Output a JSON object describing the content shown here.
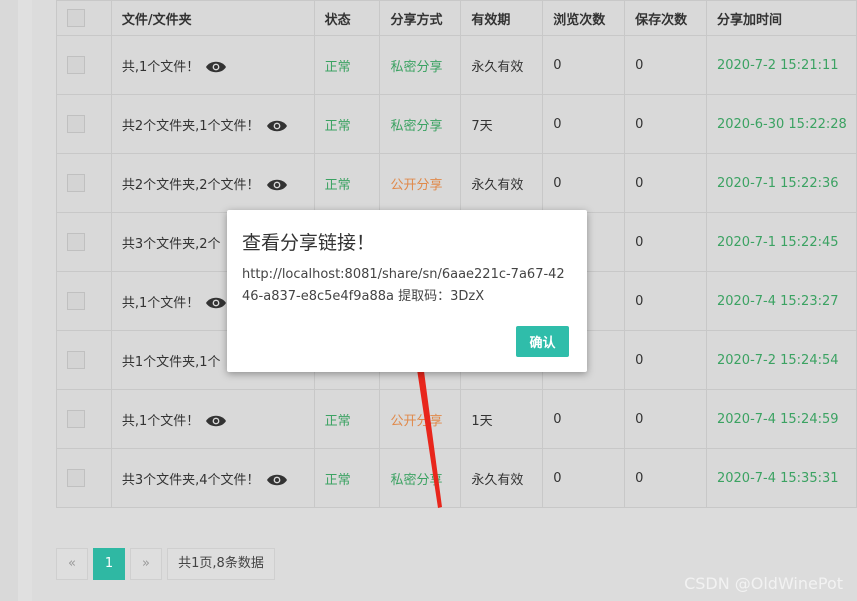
{
  "table": {
    "headers": [
      "",
      "文件/文件夹",
      "状态",
      "分享方式",
      "有效期",
      "浏览次数",
      "保存次数",
      "分享加时间"
    ],
    "rows": [
      {
        "file": "共,1个文件！",
        "status": "正常",
        "mode": "私密分享",
        "mode_color": "green",
        "validity": "永久有效",
        "views": "0",
        "saves": "0",
        "time": "2020-7-2 15:21:11"
      },
      {
        "file": "共2个文件夹,1个文件！",
        "status": "正常",
        "mode": "私密分享",
        "mode_color": "green",
        "validity": "7天",
        "views": "0",
        "saves": "0",
        "time": "2020-6-30 15:22:28"
      },
      {
        "file": "共2个文件夹,2个文件！",
        "status": "正常",
        "mode": "公开分享",
        "mode_color": "orange",
        "validity": "永久有效",
        "views": "0",
        "saves": "0",
        "time": "2020-7-1 15:22:36"
      },
      {
        "file": "共3个文件夹,2个",
        "status": "",
        "mode": "",
        "mode_color": "green",
        "validity": "",
        "views": "",
        "saves": "0",
        "time": "2020-7-1 15:22:45"
      },
      {
        "file": "共,1个文件！",
        "status": "",
        "mode": "",
        "mode_color": "green",
        "validity": "",
        "views": "",
        "saves": "0",
        "time": "2020-7-4 15:23:27"
      },
      {
        "file": "共1个文件夹,1个",
        "status": "",
        "mode": "",
        "mode_color": "green",
        "validity": "",
        "views": "",
        "saves": "0",
        "time": "2020-7-2 15:24:54"
      },
      {
        "file": "共,1个文件！",
        "status": "正常",
        "mode": "公开分享",
        "mode_color": "orange",
        "validity": "1天",
        "views": "0",
        "saves": "0",
        "time": "2020-7-4 15:24:59"
      },
      {
        "file": "共3个文件夹,4个文件！",
        "status": "正常",
        "mode": "私密分享",
        "mode_color": "green",
        "validity": "永久有效",
        "views": "0",
        "saves": "0",
        "time": "2020-7-4 15:35:31"
      }
    ]
  },
  "dialog": {
    "title": "查看分享链接！",
    "message": "http://localhost:8081/share/sn/6aae221c-7a67-4246-a837-e8c5e4f9a88a 提取码：3DzX",
    "confirm_label": "确认"
  },
  "pagination": {
    "prev": "«",
    "current": "1",
    "next": "»",
    "info": "共1页,8条数据"
  },
  "watermark": "CSDN @OldWinePot",
  "colors": {
    "accent": "#2fbdaa",
    "green_text": "#3ba262",
    "orange_text": "#e0894a",
    "arrow": "#e8261c"
  }
}
